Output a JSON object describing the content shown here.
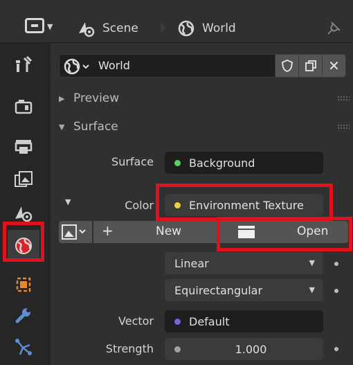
{
  "header": {
    "scene_label": "Scene",
    "world_label": "World"
  },
  "tabs": [
    {
      "name": "tool-tab",
      "icon": "tool-icon"
    },
    {
      "name": "render-tab",
      "icon": "camera-back-icon"
    },
    {
      "name": "output-tab",
      "icon": "printer-icon"
    },
    {
      "name": "view-layer-tab",
      "icon": "image-stack-icon"
    },
    {
      "name": "scene-tab",
      "icon": "scene-icon"
    },
    {
      "name": "world-tab",
      "icon": "world-icon",
      "active": true
    },
    {
      "name": "object-tab",
      "icon": "object-square-icon"
    },
    {
      "name": "modifier-tab",
      "icon": "wrench-icon"
    },
    {
      "name": "particles-tab",
      "icon": "particles-icon"
    }
  ],
  "world_datablock": {
    "name": "World"
  },
  "sections": {
    "preview": "Preview",
    "surface": "Surface"
  },
  "surface": {
    "surface_label": "Surface",
    "surface_value": "Background",
    "surface_dot_color": "#59d35b",
    "color_label": "Color",
    "color_value": "Environment Texture",
    "color_dot_color": "#e6d13e",
    "image_new_label": "New",
    "image_new_plus": "+",
    "image_open_label": "Open",
    "interpolation": "Linear",
    "projection": "Equirectangular",
    "vector_label": "Vector",
    "vector_value": "Default",
    "vector_dot_color": "#6b6bdc",
    "strength_label": "Strength",
    "strength_value": "1.000",
    "strength_dot_color": "#a1a1a1"
  },
  "highlight_color": "#e0101c"
}
